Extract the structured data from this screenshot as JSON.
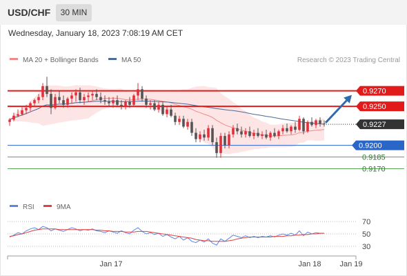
{
  "header": {
    "symbol": "USD/CHF",
    "timeframe": "30 MIN",
    "datetime": "Wednesday, January 18, 2023 7:08:19 AM CET"
  },
  "colors": {
    "up": "#e0303c",
    "down": "#555555",
    "ma20": "#f08a8a",
    "band": "#fde0e0",
    "ma50": "#4a6a9a",
    "resistance": "#e21a1a",
    "support_blue": "#2a66c8",
    "support_green": "#5aa85a",
    "forecast_arrow": "#2d6ab0",
    "rsi": "#5b86e5",
    "rsi_ma": "#e04040"
  },
  "chart_data": [
    {
      "type": "candlestick",
      "legend": [
        {
          "name": "MA 20 + Bollinger Bands",
          "color": "#f08a8a"
        },
        {
          "name": "MA 50",
          "color": "#4a6a9a"
        }
      ],
      "watermark": "Research © 2023 Trading Central",
      "y_range": [
        0.9158,
        0.9298
      ],
      "x_labels": [
        {
          "label": "Jan 17",
          "index": 24
        },
        {
          "label": "Jan 18",
          "index": 72
        },
        {
          "label": "Jan 19",
          "index": 82
        }
      ],
      "levels": [
        {
          "value": 0.927,
          "label": "0.9270",
          "kind": "resistance"
        },
        {
          "value": 0.925,
          "label": "0.9250",
          "kind": "resistance"
        },
        {
          "value": 0.92,
          "label": "0.9200",
          "kind": "support_blue"
        },
        {
          "value": 0.9185,
          "label": "0.9185",
          "kind": "support_green"
        },
        {
          "value": 0.917,
          "label": "0.9170",
          "kind": "support_green"
        }
      ],
      "last_price": {
        "value": 0.9227,
        "label": "0.9227"
      },
      "forecast": {
        "from": 0.9229,
        "to": 0.927
      },
      "candles": [
        [
          0.923,
          0.9235,
          0.9225,
          0.9233
        ],
        [
          0.9233,
          0.9242,
          0.9231,
          0.9238
        ],
        [
          0.9238,
          0.9246,
          0.9236,
          0.924
        ],
        [
          0.924,
          0.9249,
          0.9238,
          0.9245
        ],
        [
          0.9245,
          0.9252,
          0.924,
          0.9248
        ],
        [
          0.9248,
          0.9256,
          0.9244,
          0.9254
        ],
        [
          0.9254,
          0.926,
          0.925,
          0.9258
        ],
        [
          0.9258,
          0.9266,
          0.9254,
          0.9262
        ],
        [
          0.9262,
          0.928,
          0.9258,
          0.9276
        ],
        [
          0.9276,
          0.9288,
          0.9262,
          0.9266
        ],
        [
          0.9266,
          0.9272,
          0.924,
          0.9248
        ],
        [
          0.9248,
          0.9266,
          0.9246,
          0.9262
        ],
        [
          0.9262,
          0.927,
          0.9254,
          0.9258
        ],
        [
          0.9258,
          0.9264,
          0.9248,
          0.9252
        ],
        [
          0.9252,
          0.9262,
          0.9248,
          0.926
        ],
        [
          0.926,
          0.9268,
          0.9254,
          0.9264
        ],
        [
          0.9264,
          0.9272,
          0.9256,
          0.9268
        ],
        [
          0.9268,
          0.9274,
          0.9254,
          0.9258
        ],
        [
          0.9258,
          0.9266,
          0.9252,
          0.9262
        ],
        [
          0.9262,
          0.9268,
          0.9256,
          0.9264
        ],
        [
          0.9264,
          0.927,
          0.9258,
          0.9266
        ],
        [
          0.9266,
          0.9272,
          0.9258,
          0.9262
        ],
        [
          0.9262,
          0.9268,
          0.9254,
          0.9258
        ],
        [
          0.9258,
          0.9264,
          0.9252,
          0.9256
        ],
        [
          0.9256,
          0.9262,
          0.925,
          0.9254
        ],
        [
          0.9254,
          0.9262,
          0.9248,
          0.9258
        ],
        [
          0.9258,
          0.9264,
          0.925,
          0.9252
        ],
        [
          0.9252,
          0.9258,
          0.9246,
          0.925
        ],
        [
          0.925,
          0.9258,
          0.9246,
          0.9256
        ],
        [
          0.9256,
          0.9262,
          0.9248,
          0.9252
        ],
        [
          0.9252,
          0.9266,
          0.925,
          0.9264
        ],
        [
          0.9264,
          0.928,
          0.9258,
          0.9272
        ],
        [
          0.9272,
          0.9276,
          0.9256,
          0.926
        ],
        [
          0.926,
          0.9264,
          0.9248,
          0.9252
        ],
        [
          0.9252,
          0.9258,
          0.9246,
          0.9254
        ],
        [
          0.9254,
          0.9258,
          0.9244,
          0.9246
        ],
        [
          0.9246,
          0.9256,
          0.9242,
          0.9252
        ],
        [
          0.9252,
          0.9256,
          0.9238,
          0.924
        ],
        [
          0.924,
          0.925,
          0.9236,
          0.9246
        ],
        [
          0.9246,
          0.9252,
          0.9236,
          0.9238
        ],
        [
          0.9238,
          0.9242,
          0.9226,
          0.923
        ],
        [
          0.923,
          0.9238,
          0.9226,
          0.9234
        ],
        [
          0.9234,
          0.9238,
          0.9222,
          0.9224
        ],
        [
          0.9224,
          0.9234,
          0.922,
          0.923
        ],
        [
          0.923,
          0.9234,
          0.9212,
          0.9216
        ],
        [
          0.9216,
          0.9222,
          0.9204,
          0.9208
        ],
        [
          0.9208,
          0.9218,
          0.9204,
          0.9214
        ],
        [
          0.9214,
          0.922,
          0.9206,
          0.921
        ],
        [
          0.921,
          0.9226,
          0.9206,
          0.9222
        ],
        [
          0.9222,
          0.9226,
          0.92,
          0.9204
        ],
        [
          0.9204,
          0.921,
          0.9184,
          0.919
        ],
        [
          0.919,
          0.9216,
          0.9184,
          0.9212
        ],
        [
          0.9212,
          0.9216,
          0.9196,
          0.92
        ],
        [
          0.92,
          0.9218,
          0.9196,
          0.9214
        ],
        [
          0.9214,
          0.9226,
          0.921,
          0.9222
        ],
        [
          0.9222,
          0.9228,
          0.9214,
          0.9218
        ],
        [
          0.9218,
          0.9224,
          0.921,
          0.9214
        ],
        [
          0.9214,
          0.9222,
          0.921,
          0.9218
        ],
        [
          0.9218,
          0.9224,
          0.921,
          0.9212
        ],
        [
          0.9212,
          0.922,
          0.9208,
          0.9216
        ],
        [
          0.9216,
          0.9222,
          0.921,
          0.9212
        ],
        [
          0.9212,
          0.9218,
          0.9208,
          0.9214
        ],
        [
          0.9214,
          0.922,
          0.9208,
          0.921
        ],
        [
          0.921,
          0.9218,
          0.9206,
          0.9216
        ],
        [
          0.9216,
          0.9222,
          0.921,
          0.9212
        ],
        [
          0.9212,
          0.922,
          0.9208,
          0.9218
        ],
        [
          0.9218,
          0.9226,
          0.9214,
          0.9222
        ],
        [
          0.9222,
          0.9228,
          0.9216,
          0.9218
        ],
        [
          0.9218,
          0.9226,
          0.9214,
          0.9224
        ],
        [
          0.9224,
          0.923,
          0.9216,
          0.922
        ],
        [
          0.922,
          0.9238,
          0.9218,
          0.9234
        ],
        [
          0.9234,
          0.9236,
          0.9214,
          0.9218
        ],
        [
          0.9218,
          0.9232,
          0.9216,
          0.923
        ],
        [
          0.923,
          0.9236,
          0.9224,
          0.9226
        ],
        [
          0.9226,
          0.9234,
          0.9222,
          0.9232
        ],
        [
          0.9232,
          0.9236,
          0.9224,
          0.9228
        ],
        [
          0.9228,
          0.9232,
          0.9224,
          0.9227
        ]
      ]
    },
    {
      "type": "line",
      "legend": [
        {
          "name": "RSI",
          "color": "#5b86e5"
        },
        {
          "name": "9MA",
          "color": "#e04040"
        }
      ],
      "y_range": [
        20,
        80
      ],
      "y_ticks": [
        {
          "value": 70,
          "label": "70"
        },
        {
          "value": 50,
          "label": "50"
        },
        {
          "value": 30,
          "label": "30"
        }
      ],
      "series": [
        {
          "name": "RSI",
          "values": [
            45,
            48,
            52,
            50,
            55,
            58,
            60,
            57,
            62,
            60,
            55,
            58,
            56,
            54,
            57,
            60,
            58,
            55,
            57,
            56,
            58,
            55,
            54,
            52,
            55,
            53,
            51,
            55,
            52,
            50,
            56,
            60,
            54,
            50,
            52,
            49,
            51,
            46,
            49,
            45,
            42,
            46,
            40,
            44,
            38,
            36,
            40,
            37,
            42,
            35,
            32,
            42,
            38,
            43,
            48,
            46,
            44,
            47,
            44,
            46,
            44,
            46,
            45,
            47,
            45,
            48,
            50,
            48,
            51,
            48,
            55,
            47,
            53,
            50,
            52,
            51,
            51
          ]
        },
        {
          "name": "9MA",
          "values": [
            46,
            47,
            49,
            50,
            52,
            54,
            56,
            57,
            58,
            58,
            58,
            58,
            57,
            57,
            57,
            57,
            57,
            57,
            57,
            57,
            57,
            56,
            56,
            55,
            55,
            54,
            54,
            54,
            53,
            53,
            53,
            54,
            54,
            54,
            53,
            52,
            51,
            50,
            49,
            48,
            47,
            46,
            45,
            44,
            43,
            41,
            40,
            39,
            39,
            38,
            38,
            38,
            38,
            39,
            40,
            42,
            43,
            44,
            45,
            45,
            45,
            45,
            45,
            45,
            46,
            46,
            46,
            47,
            47,
            48,
            48,
            49,
            49,
            50,
            50,
            51,
            51
          ]
        }
      ]
    }
  ]
}
